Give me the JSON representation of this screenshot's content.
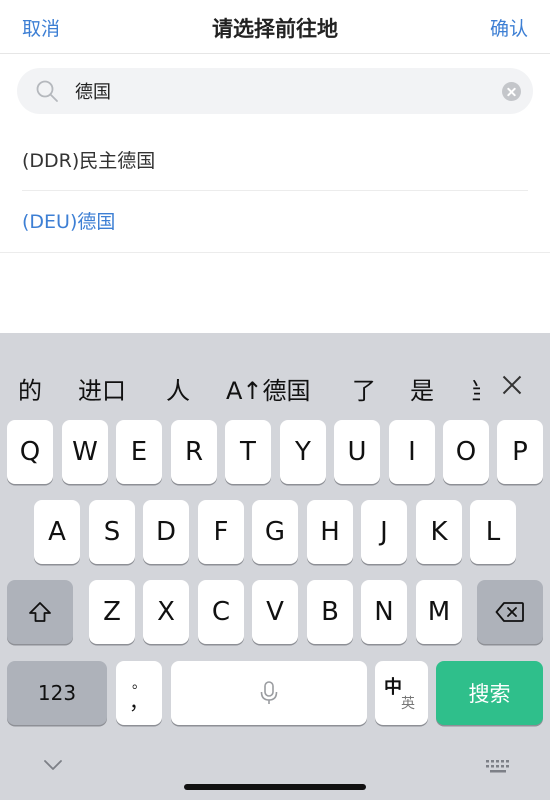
{
  "header": {
    "cancel_label": "取消",
    "title": "请选择前往地",
    "confirm_label": "确认"
  },
  "search": {
    "value": "德国"
  },
  "results": [
    {
      "label": "(DDR)民主德国",
      "color": "#333333"
    },
    {
      "label": "(DEU)德国",
      "color": "#3d7fd4"
    }
  ],
  "keyboard": {
    "candidates": [
      "的",
      "进口",
      "人",
      "A↑德国",
      "了",
      "是",
      "当"
    ],
    "row1": [
      "Q",
      "W",
      "E",
      "R",
      "T",
      "Y",
      "U",
      "I",
      "O",
      "P"
    ],
    "row2": [
      "A",
      "S",
      "D",
      "F",
      "G",
      "H",
      "J",
      "K",
      "L"
    ],
    "row3": [
      "Z",
      "X",
      "C",
      "V",
      "B",
      "N",
      "M"
    ],
    "num_label": "123",
    "punct_label": "，",
    "punct_top": "。",
    "lang_top": "中",
    "lang_bottom": "英",
    "search_label": "搜索"
  },
  "colors": {
    "accent": "#3d7fd4",
    "search_key": "#2fbf8b",
    "keyboard_bg": "#d3d5da"
  }
}
